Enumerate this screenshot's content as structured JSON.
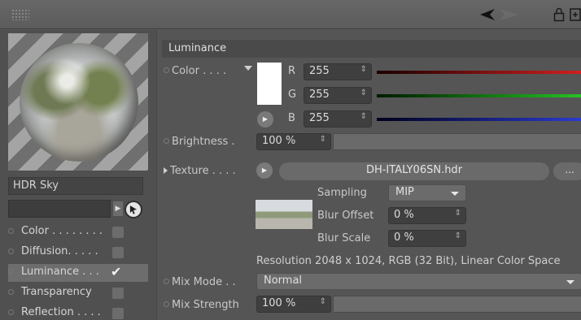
{
  "topbar": {
    "icons": [
      "grip-icon",
      "back-arrow-icon",
      "forward-arrow-icon",
      "lock-icon",
      "new-window-icon"
    ]
  },
  "material": {
    "name": "HDR Sky",
    "preview_icon": "material-sphere-preview",
    "channels": [
      {
        "label": "Color . . . . . . . .",
        "checked": false
      },
      {
        "label": "Diffusion. . . . .",
        "checked": false
      },
      {
        "label": "Luminance . . .",
        "checked": true
      },
      {
        "label": "Transparency",
        "checked": false
      },
      {
        "label": "Reflection . . . .",
        "checked": false
      }
    ]
  },
  "section": {
    "title": "Luminance"
  },
  "color": {
    "label": "Color . . . .",
    "r_letter": "R",
    "g_letter": "G",
    "b_letter": "B",
    "r": "255",
    "g": "255",
    "b": "255",
    "swatch": "#ffffff",
    "r_color": "#d21f1f",
    "g_color": "#24c324",
    "b_color": "#2a3ad0"
  },
  "brightness": {
    "label": "Brightness .",
    "value": "100 %"
  },
  "texture": {
    "label": "Texture . . . .",
    "path": "DH-ITALY06SN.hdr",
    "more_label": "...",
    "sampling_label": "Sampling",
    "sampling_value": "MIP",
    "blur_offset_label": "Blur Offset",
    "blur_offset_value": "0 %",
    "blur_scale_label": "Blur Scale",
    "blur_scale_value": "0 %",
    "resolution": "Resolution 2048 x 1024, RGB (32 Bit), Linear Color Space"
  },
  "mix_mode": {
    "label": "Mix Mode . .",
    "value": "Normal"
  },
  "mix_strength": {
    "label": "Mix Strength",
    "value": "100 %"
  }
}
